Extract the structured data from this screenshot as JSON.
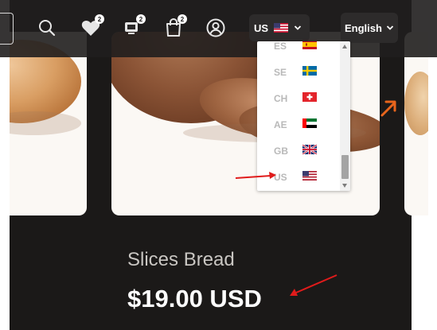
{
  "header": {
    "cart_badge": "2",
    "wishlist_badge": "2",
    "compare_badge": "2",
    "bag_badge": "2"
  },
  "country_selector": {
    "selected": "US",
    "selected_flag": "flag-us-icon"
  },
  "language_selector": {
    "selected": "English"
  },
  "country_dropdown": {
    "options": [
      {
        "code": "ES",
        "flag": "flag-es-icon"
      },
      {
        "code": "SE",
        "flag": "flag-se-icon"
      },
      {
        "code": "CH",
        "flag": "flag-ch-icon"
      },
      {
        "code": "AE",
        "flag": "flag-ae-icon"
      },
      {
        "code": "GB",
        "flag": "flag-gb-icon"
      },
      {
        "code": "US",
        "flag": "flag-us-icon"
      }
    ]
  },
  "product": {
    "title": "Slices Bread",
    "price": "$19.00 USD"
  },
  "colors": {
    "page_bg": "#1b1918",
    "annotation_red": "#e01b1b",
    "carousel_arrow": "#e8651c"
  }
}
